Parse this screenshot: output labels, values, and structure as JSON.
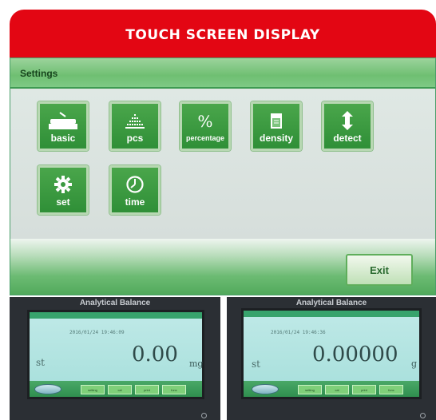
{
  "banner": {
    "title": "TOUCH SCREEN DISPLAY"
  },
  "colors": {
    "banner_red": "#e30613",
    "tile_green": "#3a9a40",
    "band_green": "#6cbb73"
  },
  "settings": {
    "title": "Settings",
    "tiles": [
      {
        "label": "basic",
        "icon": "balance-icon"
      },
      {
        "label": "pcs",
        "icon": "count-dots-icon"
      },
      {
        "label": "percentage",
        "icon": "percent-icon"
      },
      {
        "label": "density",
        "icon": "beaker-icon"
      },
      {
        "label": "detect",
        "icon": "up-down-arrow-icon"
      },
      {
        "label": "set",
        "icon": "gear-icon"
      },
      {
        "label": "time",
        "icon": "clock-icon"
      }
    ],
    "exit_label": "Exit"
  },
  "balances": [
    {
      "title": "Analytical Balance",
      "datetime": "2016/01/24 19:46:09",
      "mode": "st",
      "reading": "0.00",
      "unit": "mg",
      "softkeys": [
        "setting",
        "cal",
        "print",
        "func"
      ]
    },
    {
      "title": "Analytical Balance",
      "datetime": "2016/01/24 19:46:36",
      "mode": "st",
      "reading": "0.00000",
      "unit": "g",
      "softkeys": [
        "setting",
        "cal",
        "print",
        "func"
      ]
    }
  ]
}
